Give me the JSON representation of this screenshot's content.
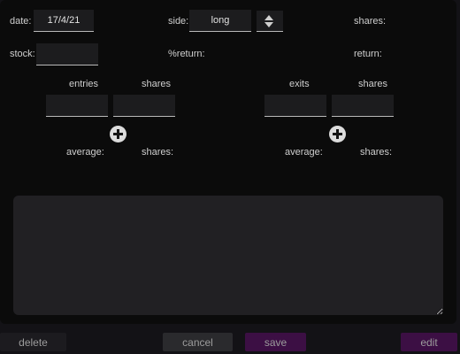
{
  "form": {
    "date_label": "date:",
    "date_value": "17/4/21",
    "side_label": "side:",
    "side_value": "long",
    "shares_label": "shares:",
    "stock_label": "stock:",
    "stock_value": "",
    "return_pct_label": "%return:",
    "return_label": "return:"
  },
  "entries": {
    "col_label": "entries",
    "shares_label": "shares",
    "average_label": "average:",
    "shares_total_label": "shares:"
  },
  "exits": {
    "col_label": "exits",
    "shares_label": "shares",
    "average_label": "average:",
    "shares_total_label": "shares:"
  },
  "notes": {
    "value": ""
  },
  "buttons": {
    "delete": "delete",
    "cancel": "cancel",
    "save": "save",
    "edit": "edit"
  },
  "colors": {
    "background": "#131216",
    "panel": "#0b0b0b",
    "field": "#1c1c1e",
    "accent_purple": "#3c0f44",
    "button_dark": "#2a2a2d"
  },
  "icons": {
    "stepper": "up-down-arrows-icon",
    "add": "plus-circle-icon"
  }
}
